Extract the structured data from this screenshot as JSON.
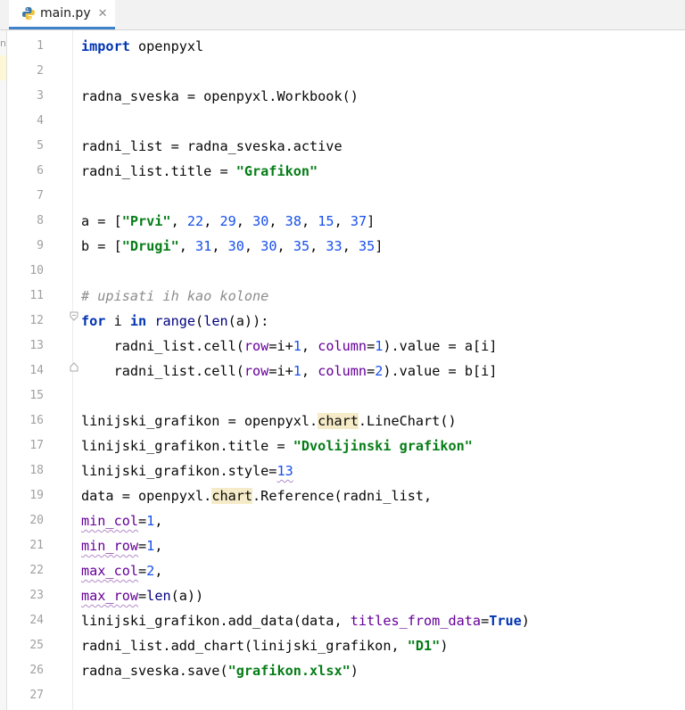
{
  "tab": {
    "label": "main.py",
    "close": "✕",
    "icon": "python-file-icon"
  },
  "side": {
    "label": "nc"
  },
  "gutter": {
    "numbers": [
      "1",
      "2",
      "3",
      "4",
      "5",
      "6",
      "7",
      "8",
      "9",
      "10",
      "11",
      "12",
      "13",
      "14",
      "15",
      "16",
      "17",
      "18",
      "19",
      "20",
      "21",
      "22",
      "23",
      "24",
      "25",
      "26",
      "27"
    ]
  },
  "code": {
    "lines": [
      [
        {
          "t": "import",
          "c": "kw"
        },
        {
          "t": " openpyxl"
        }
      ],
      [],
      [
        {
          "t": "radna_sveska = openpyxl.Workbook()"
        }
      ],
      [],
      [
        {
          "t": "radni_list = radna_sveska.active"
        }
      ],
      [
        {
          "t": "radni_list.title = "
        },
        {
          "t": "\"Grafikon\"",
          "c": "str"
        }
      ],
      [],
      [
        {
          "t": "a = ["
        },
        {
          "t": "\"Prvi\"",
          "c": "str"
        },
        {
          "t": ", "
        },
        {
          "t": "22",
          "c": "num"
        },
        {
          "t": ", "
        },
        {
          "t": "29",
          "c": "num"
        },
        {
          "t": ", "
        },
        {
          "t": "30",
          "c": "num"
        },
        {
          "t": ", "
        },
        {
          "t": "38",
          "c": "num"
        },
        {
          "t": ", "
        },
        {
          "t": "15",
          "c": "num"
        },
        {
          "t": ", "
        },
        {
          "t": "37",
          "c": "num"
        },
        {
          "t": "]"
        }
      ],
      [
        {
          "t": "b = ["
        },
        {
          "t": "\"Drugi\"",
          "c": "str"
        },
        {
          "t": ", "
        },
        {
          "t": "31",
          "c": "num"
        },
        {
          "t": ", "
        },
        {
          "t": "30",
          "c": "num"
        },
        {
          "t": ", "
        },
        {
          "t": "30",
          "c": "num"
        },
        {
          "t": ", "
        },
        {
          "t": "35",
          "c": "num"
        },
        {
          "t": ", "
        },
        {
          "t": "33",
          "c": "num"
        },
        {
          "t": ", "
        },
        {
          "t": "35",
          "c": "num"
        },
        {
          "t": "]"
        }
      ],
      [],
      [
        {
          "t": "# upisati ih kao kolone",
          "c": "cm"
        }
      ],
      [
        {
          "t": "for",
          "c": "kw"
        },
        {
          "t": " i "
        },
        {
          "t": "in",
          "c": "kw"
        },
        {
          "t": " "
        },
        {
          "t": "range",
          "c": "builtin"
        },
        {
          "t": "("
        },
        {
          "t": "len",
          "c": "builtin"
        },
        {
          "t": "(a)):"
        }
      ],
      [
        {
          "t": "    radni_list.cell("
        },
        {
          "t": "row",
          "c": "param"
        },
        {
          "t": "=i+"
        },
        {
          "t": "1",
          "c": "num"
        },
        {
          "t": ", "
        },
        {
          "t": "column",
          "c": "param"
        },
        {
          "t": "="
        },
        {
          "t": "1",
          "c": "num"
        },
        {
          "t": ").value = a[i]"
        }
      ],
      [
        {
          "t": "    radni_list.cell("
        },
        {
          "t": "row",
          "c": "param"
        },
        {
          "t": "=i+"
        },
        {
          "t": "1",
          "c": "num"
        },
        {
          "t": ", "
        },
        {
          "t": "column",
          "c": "param"
        },
        {
          "t": "="
        },
        {
          "t": "2",
          "c": "num"
        },
        {
          "t": ").value = b[i]"
        }
      ],
      [],
      [
        {
          "t": "linijski_grafikon = openpyxl."
        },
        {
          "t": "chart",
          "c": "hl-word"
        },
        {
          "t": ".LineChart()"
        }
      ],
      [
        {
          "t": "linijski_grafikon.title = "
        },
        {
          "t": "\"Dvolijinski grafikon\"",
          "c": "str"
        }
      ],
      [
        {
          "t": "linijski_grafikon.style="
        },
        {
          "t": "13",
          "c": "num squig"
        }
      ],
      [
        {
          "t": "data = openpyxl."
        },
        {
          "t": "chart",
          "c": "hl-word"
        },
        {
          "t": ".Reference(radni_list,"
        }
      ],
      [
        {
          "t": "min_col",
          "c": "param squig"
        },
        {
          "t": "="
        },
        {
          "t": "1",
          "c": "num"
        },
        {
          "t": ","
        }
      ],
      [
        {
          "t": "min_row",
          "c": "param squig"
        },
        {
          "t": "="
        },
        {
          "t": "1",
          "c": "num"
        },
        {
          "t": ","
        }
      ],
      [
        {
          "t": "max_col",
          "c": "param squig"
        },
        {
          "t": "="
        },
        {
          "t": "2",
          "c": "num"
        },
        {
          "t": ","
        }
      ],
      [
        {
          "t": "max_row",
          "c": "param squig"
        },
        {
          "t": "="
        },
        {
          "t": "len",
          "c": "builtin"
        },
        {
          "t": "(a))"
        }
      ],
      [
        {
          "t": "linijski_grafikon.add_data(data, "
        },
        {
          "t": "titles_from_data",
          "c": "param"
        },
        {
          "t": "="
        },
        {
          "t": "True",
          "c": "kw"
        },
        {
          "t": ")"
        }
      ],
      [
        {
          "t": "radni_list.add_chart(linijski_grafikon, "
        },
        {
          "t": "\"D1\"",
          "c": "str"
        },
        {
          "t": ")"
        }
      ],
      [
        {
          "t": "radna_sveska.save("
        },
        {
          "t": "\"grafikon.xlsx\"",
          "c": "str"
        },
        {
          "t": ")"
        }
      ],
      []
    ]
  }
}
